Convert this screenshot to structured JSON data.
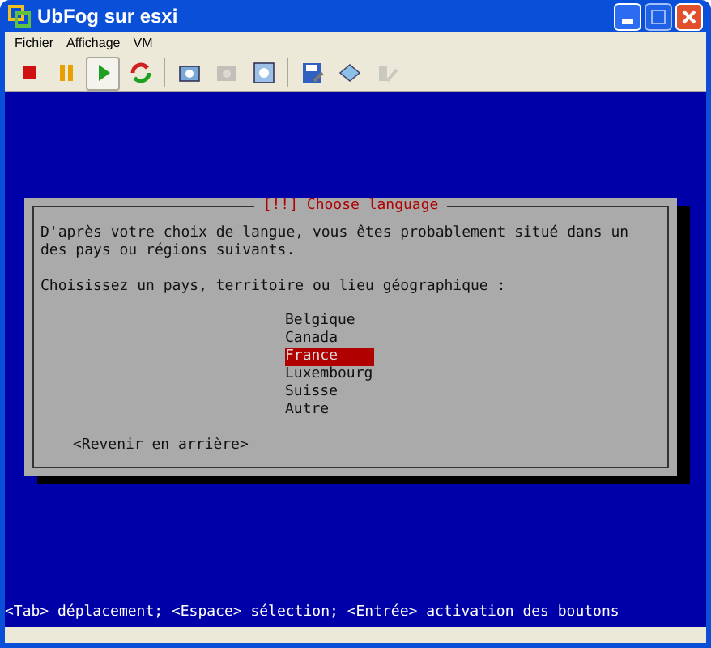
{
  "window": {
    "title": "UbFog sur esxi"
  },
  "menu": [
    "Fichier",
    "Affichage",
    "VM"
  ],
  "toolbar": [
    {
      "kind": "stop",
      "disabled": false,
      "selected": false
    },
    {
      "kind": "pause",
      "disabled": false,
      "selected": false
    },
    {
      "kind": "play",
      "disabled": false,
      "selected": true
    },
    {
      "kind": "reset",
      "disabled": false,
      "selected": false
    },
    {
      "kind": "snapshot",
      "disabled": false,
      "selected": false
    },
    {
      "kind": "revert",
      "disabled": true,
      "selected": false
    },
    {
      "kind": "manager",
      "disabled": false,
      "selected": false
    },
    {
      "kind": "disk",
      "disabled": false,
      "selected": false
    },
    {
      "kind": "network",
      "disabled": false,
      "selected": false
    },
    {
      "kind": "tools",
      "disabled": true,
      "selected": false
    }
  ],
  "dialog": {
    "title": "[!!] Choose language",
    "description": [
      "D'après votre choix de langue, vous êtes probablement situé dans un",
      "des pays ou régions suivants."
    ],
    "prompt": "Choisissez un pays, territoire ou lieu géographique :",
    "options": [
      {
        "label": "Belgique",
        "selected": false
      },
      {
        "label": "Canada",
        "selected": false
      },
      {
        "label": "France",
        "selected": true
      },
      {
        "label": "Luxembourg",
        "selected": false
      },
      {
        "label": "Suisse",
        "selected": false
      },
      {
        "label": "Autre",
        "selected": false
      }
    ],
    "back_button": "<Revenir en arrière>"
  },
  "help_line": "<Tab> déplacement; <Espace> sélection; <Entrée> activation des boutons"
}
